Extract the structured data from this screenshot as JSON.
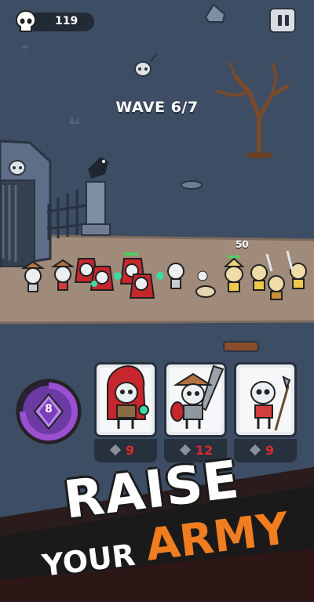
{
  "hud": {
    "skull_count": "119",
    "skull_icon": "skull-icon",
    "pause_icon": "pause-icon"
  },
  "wave": {
    "label": "WAVE 6/7"
  },
  "battle": {
    "damage_number": "50"
  },
  "mana": {
    "count": "8",
    "icon": "mana-crystal-icon"
  },
  "cards": [
    {
      "unit": "red-hooded-skeleton-mage",
      "cost": "9"
    },
    {
      "unit": "skeleton-swordsman",
      "cost": "12"
    },
    {
      "unit": "skeleton-spearman",
      "cost": "9"
    }
  ],
  "banner": {
    "line1": "RAISE",
    "line2a": "YOUR",
    "line2b": "ARMY"
  },
  "colors": {
    "background": "#3d4d63",
    "ground": "#a08a7a",
    "cost_text": "#d92b2b",
    "army_text": "#f07d1f",
    "banner_bg": "#1a1a1a",
    "mana_gem": "#9b4fd1"
  }
}
